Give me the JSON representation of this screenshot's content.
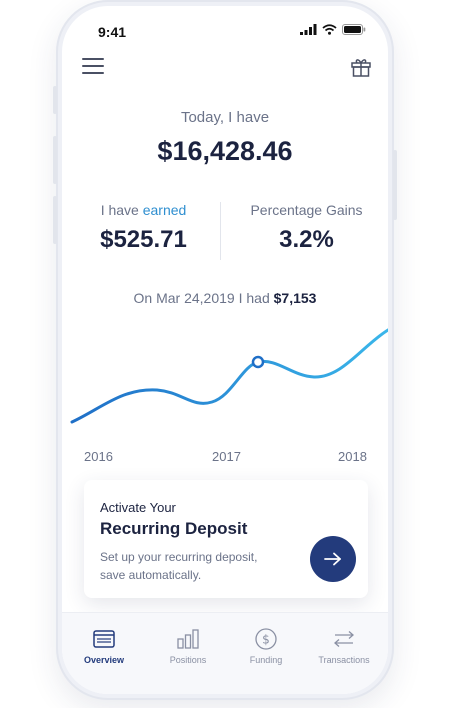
{
  "status_bar": {
    "time": "9:41"
  },
  "header": {
    "menu_icon": "hamburger-menu-icon",
    "gift_icon": "gift-icon"
  },
  "summary": {
    "today_label": "Today, I have",
    "balance": "$16,428.46"
  },
  "stats": {
    "earned_prefix": "I have ",
    "earned_accent": "earned",
    "earned_value": "$525.71",
    "gains_label": "Percentage Gains",
    "gains_value": "3.2%"
  },
  "history": {
    "prefix": "On Mar 24,2019 I had ",
    "amount": "$7,153"
  },
  "chart_data": {
    "type": "line",
    "x_tick_labels": [
      "2016",
      "2017",
      "2018"
    ],
    "highlight_label": "On Mar 24,2019 I had $7,153",
    "colors": {
      "line_start": "#1f6fc7",
      "line_end": "#3ab6ea"
    }
  },
  "card": {
    "kicker": "Activate Your",
    "title": "Recurring Deposit",
    "description": "Set up your recurring deposit, save automatically.",
    "button_icon": "arrow-right-icon"
  },
  "tabs": [
    {
      "label": "Overview",
      "icon": "overview-icon",
      "active": true
    },
    {
      "label": "Positions",
      "icon": "bar-chart-icon",
      "active": false
    },
    {
      "label": "Funding",
      "icon": "dollar-circle-icon",
      "active": false
    },
    {
      "label": "Transactions",
      "icon": "transfer-arrows-icon",
      "active": false
    }
  ],
  "colors": {
    "accent": "#2f8fd0",
    "primary": "#233b7c",
    "text": "#1c2340",
    "muted": "#6b7389"
  }
}
